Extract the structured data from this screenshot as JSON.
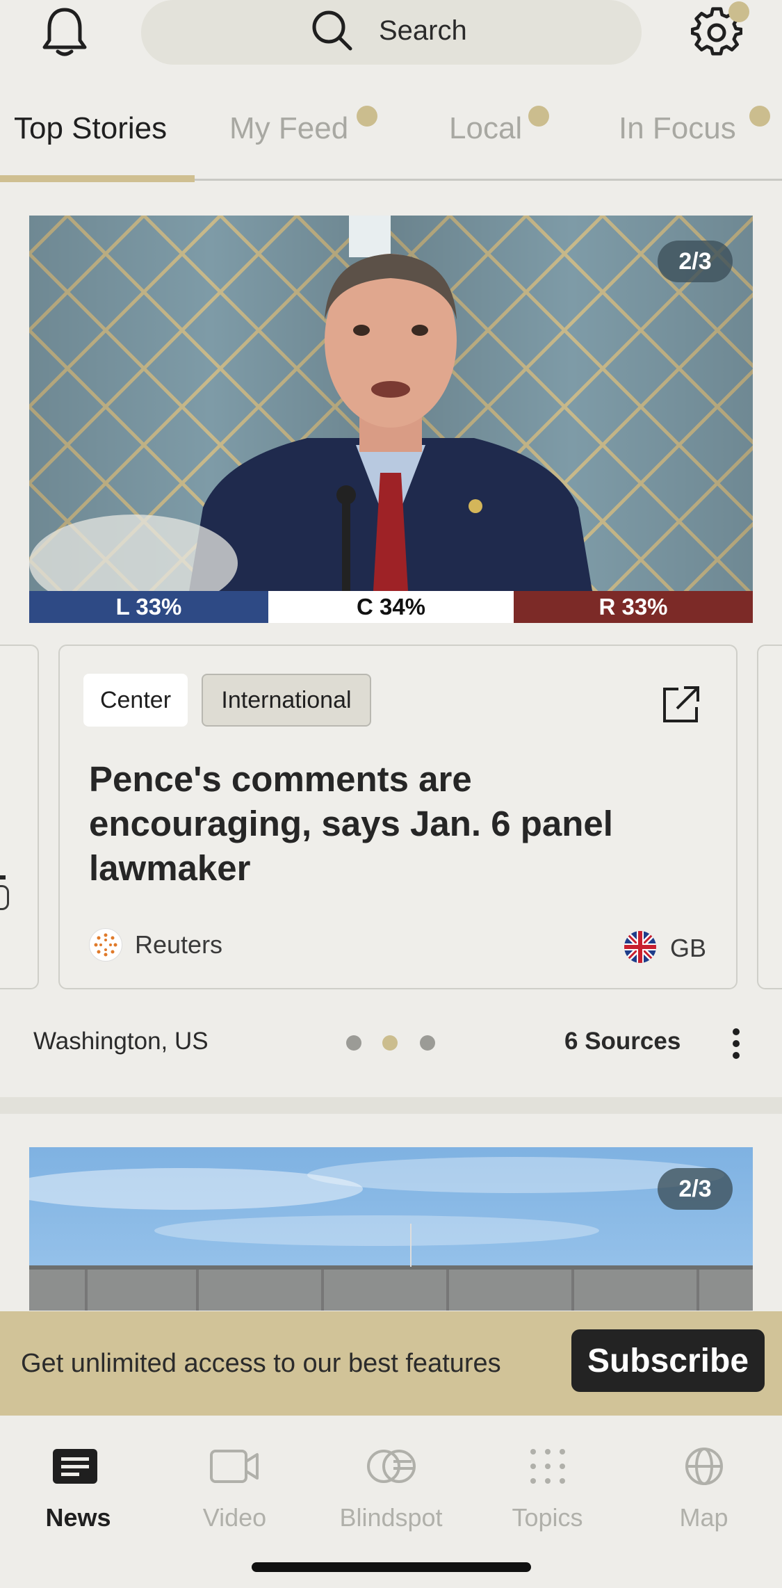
{
  "header": {
    "search_placeholder": "Search",
    "icons": {
      "notifications": "bell-icon",
      "search": "search-icon",
      "settings": "gear-icon"
    }
  },
  "tabs": [
    {
      "label": "Top Stories",
      "active": true
    },
    {
      "label": "My Feed",
      "active": false
    },
    {
      "label": "Local",
      "active": false
    },
    {
      "label": "In Focus",
      "active": false
    }
  ],
  "story": {
    "image_counter": "2/3",
    "bias": {
      "left": "L 33%",
      "center": "C 34%",
      "right": "R 33%"
    },
    "card": {
      "tags": [
        "Center",
        "International"
      ],
      "headline": "Pence's comments are encouraging, says Jan. 6 panel lawmaker",
      "source": "Reuters",
      "country": "GB"
    },
    "location": "Washington, US",
    "sources_count": "6 Sources",
    "pagination": {
      "total": 3,
      "active_index": 1
    }
  },
  "story2": {
    "image_counter": "2/3"
  },
  "banner": {
    "text": "Get unlimited access to our best features",
    "button": "Subscribe"
  },
  "bottom_nav": [
    {
      "label": "News",
      "icon": "news-icon",
      "active": true
    },
    {
      "label": "Video",
      "icon": "video-icon",
      "active": false
    },
    {
      "label": "Blindspot",
      "icon": "blindspot-icon",
      "active": false
    },
    {
      "label": "Topics",
      "icon": "topics-icon",
      "active": false
    },
    {
      "label": "Map",
      "icon": "globe-icon",
      "active": false
    }
  ],
  "colors": {
    "accent_gold": "#cbbd8e",
    "bias_left": "#2e4a85",
    "bias_center": "#ffffff",
    "bias_right": "#7c2a27",
    "background": "#eeede9"
  }
}
